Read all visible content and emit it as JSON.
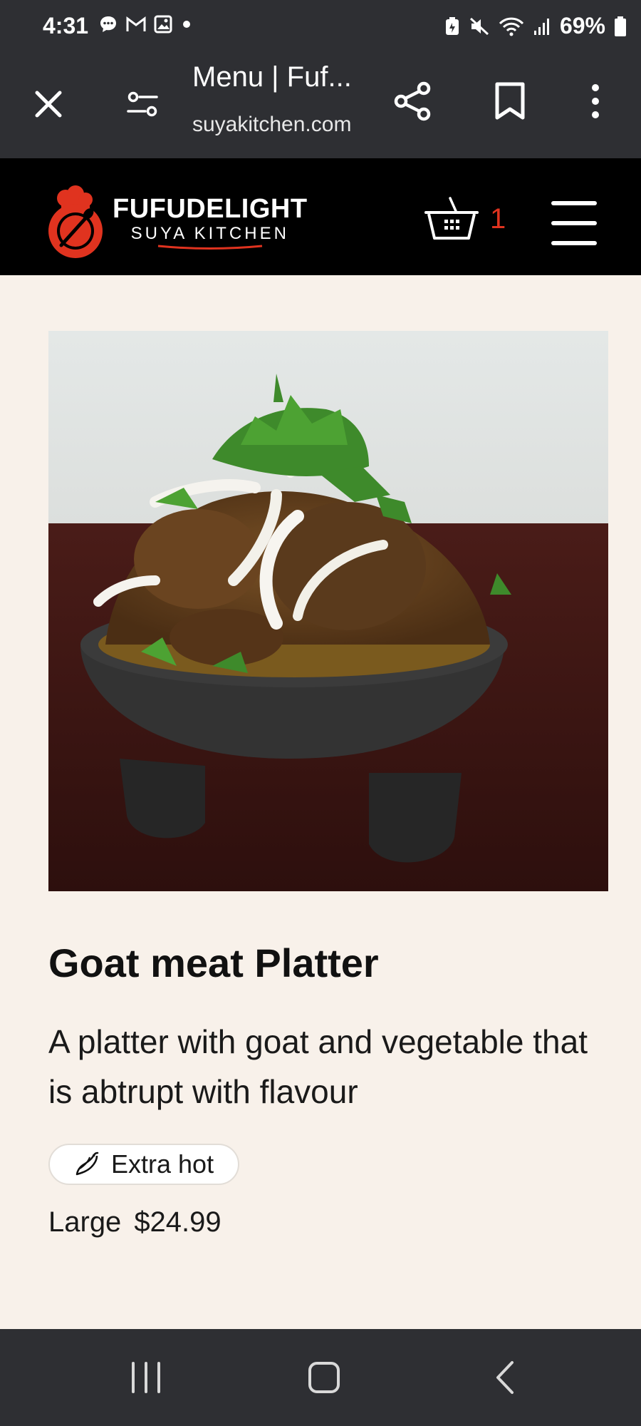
{
  "status_bar": {
    "time": "4:31",
    "battery": "69%",
    "left_icons": [
      "chat-icon",
      "gmail-icon",
      "gallery-icon",
      "dot-icon"
    ],
    "right_icons": [
      "battery-saver-icon",
      "mute-icon",
      "wifi-icon",
      "signal-icon",
      "battery-icon"
    ]
  },
  "browser": {
    "title": "Menu | Fuf...",
    "url": "suyakitchen.com"
  },
  "site": {
    "logo_main": "FUFUDELIGHT",
    "logo_sub": "SUYA KITCHEN",
    "cart_count": "1",
    "brand_color": "#e0331f"
  },
  "product": {
    "title": "Goat meat Platter",
    "description": "A platter with goat and vegetable that is abtrupt with flavour",
    "spice_label": "Extra hot",
    "spice_icon": "chili-pepper-icon",
    "size": "Large",
    "price": "$24.99"
  },
  "nav": {
    "buttons": [
      "recent-apps",
      "home",
      "back"
    ]
  }
}
